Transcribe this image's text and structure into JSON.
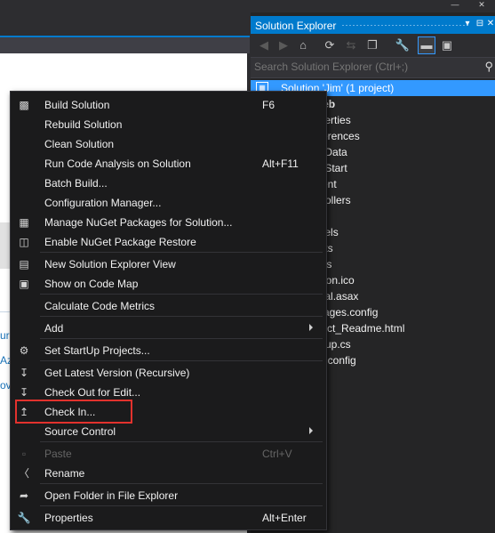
{
  "solution_explorer": {
    "title": "Solution Explorer",
    "search_placeholder": "Search Solution Explorer (Ctrl+;)",
    "solution_label": "Solution 'Jim' (1 project)",
    "tree_items": [
      "Web",
      "operties",
      "eferences",
      "p_Data",
      "p_Start",
      "ntent",
      "ntrollers",
      "nts",
      "odels",
      "ripts",
      "ews",
      "vicon.ico",
      "obal.asax",
      "ckages.config",
      "oject_Readme.html",
      "artup.cs",
      "eb.config"
    ]
  },
  "background_fragments": [
    "ur",
    "Azu",
    "ov"
  ],
  "context_menu": {
    "items": [
      {
        "label": "Build Solution",
        "shortcut": "F6",
        "icon": "build-icon"
      },
      {
        "label": "Rebuild Solution",
        "shortcut": "",
        "icon": ""
      },
      {
        "label": "Clean Solution",
        "shortcut": "",
        "icon": ""
      },
      {
        "label": "Run Code Analysis on Solution",
        "shortcut": "Alt+F11",
        "icon": ""
      },
      {
        "label": "Batch Build...",
        "shortcut": "",
        "icon": ""
      },
      {
        "label": "Configuration Manager...",
        "shortcut": "",
        "icon": ""
      },
      {
        "label": "Manage NuGet Packages for Solution...",
        "shortcut": "",
        "icon": "nuget-icon"
      },
      {
        "label": "Enable NuGet Package Restore",
        "shortcut": "",
        "icon": "package-restore-icon"
      },
      {
        "label": "New Solution Explorer View",
        "shortcut": "",
        "icon": "new-view-icon"
      },
      {
        "label": "Show on Code Map",
        "shortcut": "",
        "icon": "code-map-icon"
      },
      {
        "label": "Calculate Code Metrics",
        "shortcut": "",
        "icon": ""
      },
      {
        "label": "Add",
        "shortcut": "",
        "icon": ""
      },
      {
        "label": "Set StartUp Projects...",
        "shortcut": "",
        "icon": "gear-icon"
      },
      {
        "label": "Get Latest Version (Recursive)",
        "shortcut": "",
        "icon": "get-latest-icon"
      },
      {
        "label": "Check Out for Edit...",
        "shortcut": "",
        "icon": "check-out-icon"
      },
      {
        "label": "Check In...",
        "shortcut": "",
        "icon": "check-in-icon"
      },
      {
        "label": "Source Control",
        "shortcut": "",
        "icon": ""
      },
      {
        "label": "Paste",
        "shortcut": "Ctrl+V",
        "icon": "paste-icon"
      },
      {
        "label": "Rename",
        "shortcut": "",
        "icon": "rename-icon"
      },
      {
        "label": "Open Folder in File Explorer",
        "shortcut": "",
        "icon": "open-folder-icon"
      },
      {
        "label": "Properties",
        "shortcut": "Alt+Enter",
        "icon": "wrench-icon"
      }
    ]
  },
  "colors": {
    "accent": "#007acc",
    "selection": "#3399ff",
    "highlight_border": "#e2322d",
    "menu_background": "#1b1b1c"
  }
}
